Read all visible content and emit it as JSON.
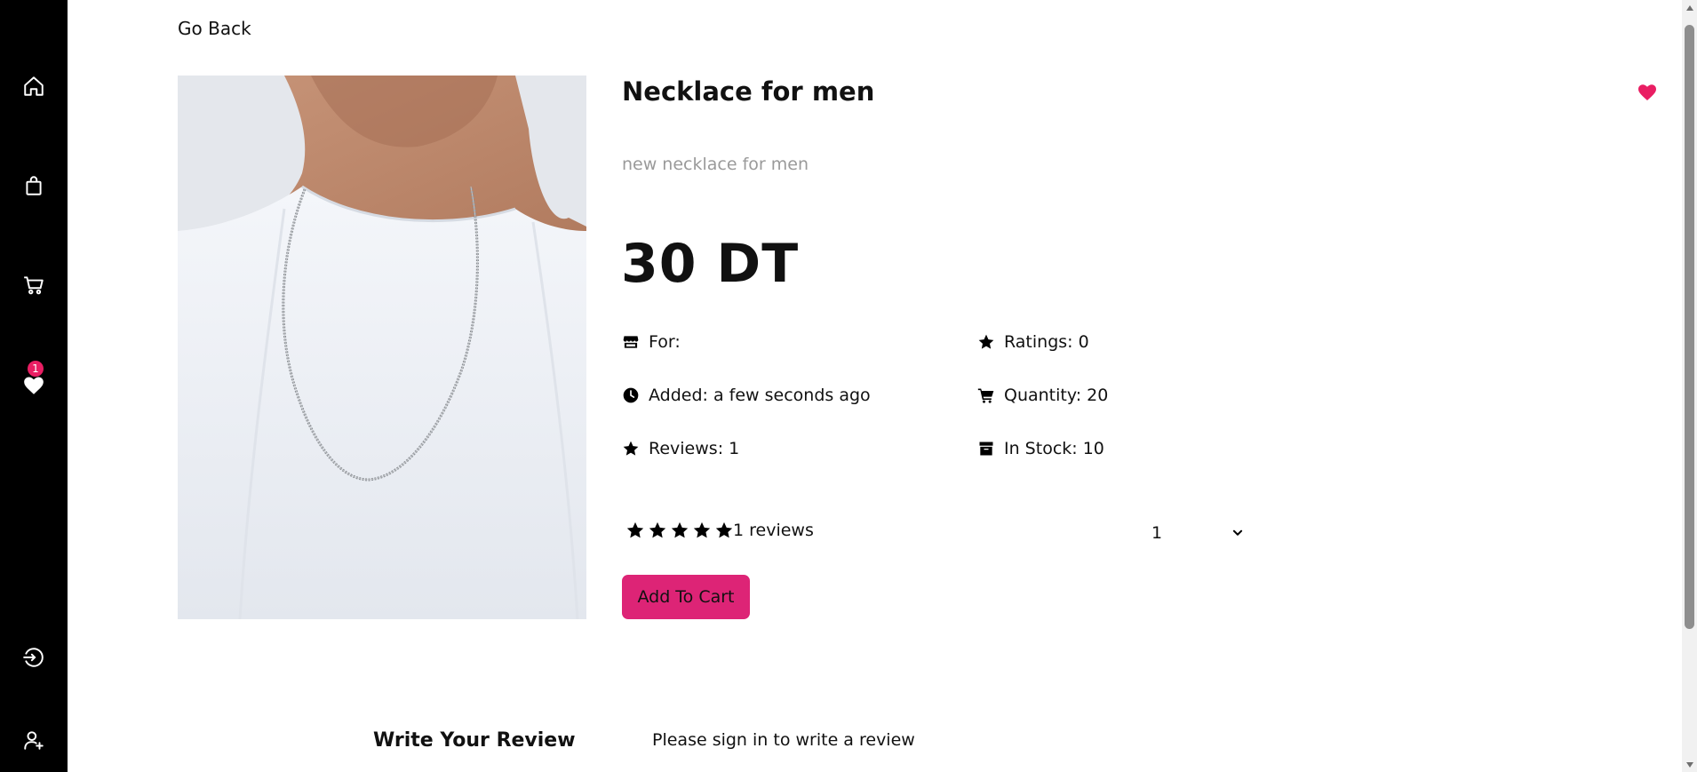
{
  "sidebar": {
    "items": [
      {
        "name": "home",
        "icon": "home-icon"
      },
      {
        "name": "shop",
        "icon": "shopping-bag-icon"
      },
      {
        "name": "cart",
        "icon": "cart-icon"
      },
      {
        "name": "favorites",
        "icon": "heart-icon",
        "badge": "1"
      },
      {
        "name": "login",
        "icon": "sign-in-icon"
      },
      {
        "name": "register",
        "icon": "user-plus-icon"
      }
    ]
  },
  "nav": {
    "go_back": "Go Back"
  },
  "product": {
    "title": "Necklace for men",
    "description": "new necklace for men",
    "price": "30 DT",
    "image_icon": "necklace-photo",
    "favorite_icon": "heart-icon",
    "info_left": [
      {
        "icon": "store-icon",
        "label": "For:"
      },
      {
        "icon": "clock-icon",
        "label": "Added: a few seconds ago"
      },
      {
        "icon": "star-icon",
        "label": "Reviews: 1"
      }
    ],
    "info_right": [
      {
        "icon": "star-icon",
        "label": "Ratings: 0"
      },
      {
        "icon": "cart-icon",
        "label": "Quantity: 20"
      },
      {
        "icon": "box-icon",
        "label": "In Stock: 10"
      }
    ],
    "rating": {
      "stars": 5,
      "reviews_text": "1 reviews"
    },
    "quantity_select": {
      "selected": "1"
    },
    "add_to_cart": "Add To Cart"
  },
  "reviews": {
    "heading": "Write Your Review",
    "signin_note": "Please sign in to write a review"
  },
  "colors": {
    "accent": "#dd2476",
    "sidebar_bg": "#000000",
    "description": "#9a9a9a",
    "favorite_heart": "#e91e63"
  }
}
